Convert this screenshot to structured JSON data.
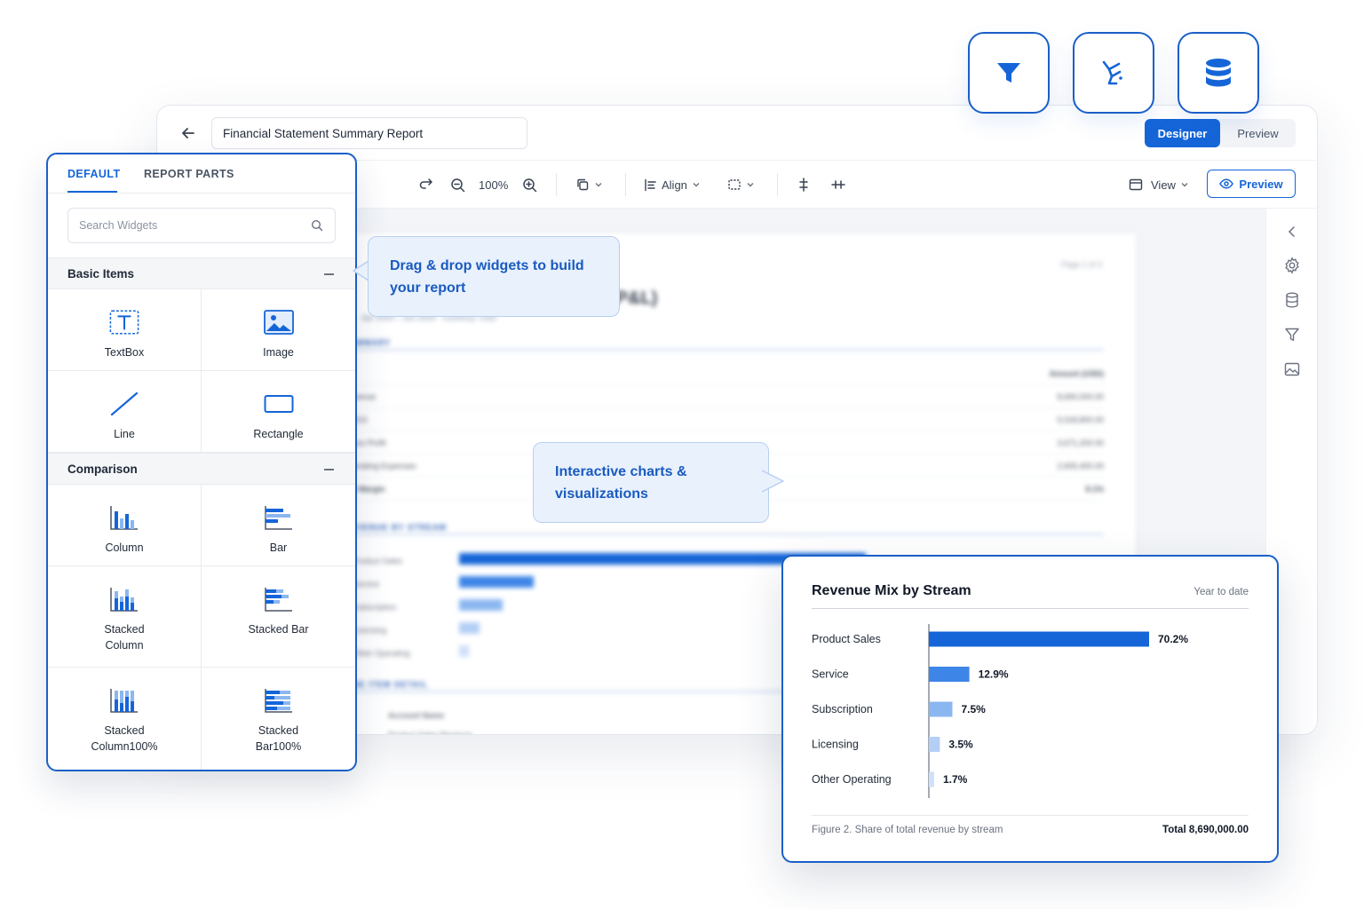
{
  "floating_tools": [
    {
      "name": "filter",
      "icon": "filter-icon"
    },
    {
      "name": "query",
      "icon": "wand-icon"
    },
    {
      "name": "data-source",
      "icon": "database-icon"
    }
  ],
  "header": {
    "report_title": "Financial Statement Summary Report",
    "mode_designer": "Designer",
    "mode_preview": "Preview"
  },
  "toolbar": {
    "zoom": "100%",
    "align_label": "Align",
    "view_label": "View",
    "preview_label": "Preview"
  },
  "widgets_panel": {
    "tabs": [
      "DEFAULT",
      "REPORT PARTS"
    ],
    "active_tab": 0,
    "search_placeholder": "Search Widgets",
    "groups": [
      {
        "label": "Basic Items",
        "items": [
          "TextBox",
          "Image",
          "Line",
          "Rectangle"
        ]
      },
      {
        "label": "Comparison",
        "items": [
          "Column",
          "Bar",
          "Stacked Column",
          "Stacked Bar",
          "Stacked Column100%",
          "Stacked Bar100%"
        ]
      }
    ]
  },
  "callouts": {
    "drag_drop": "Drag & drop widgets to build your report",
    "interactive": "Interactive charts & visualizations"
  },
  "revenue_card": {
    "title": "Revenue Mix by Stream",
    "period": "Year to date",
    "caption": "Figure 2. Share of total revenue by stream",
    "total": "Total 8,690,000.00"
  },
  "chart_data": {
    "type": "bar",
    "orientation": "horizontal",
    "title": "Revenue Mix by Stream",
    "subtitle": "Year to date",
    "categories": [
      "Product Sales",
      "Service",
      "Subscription",
      "Licensing",
      "Other Operating"
    ],
    "values": [
      70.2,
      12.9,
      7.5,
      3.5,
      1.7
    ],
    "data_labels": [
      "70.2%",
      "12.9%",
      "7.5%",
      "3.5%",
      "1.7%"
    ],
    "colors": [
      "#1565d8",
      "#3d85e6",
      "#8bb7f0",
      "#b3cff6",
      "#cfe0fa"
    ],
    "xlim": [
      0,
      70.2
    ],
    "grid": false,
    "legend": "none"
  },
  "colors": {
    "accent": "#1565d8",
    "border_accent": "#1a5fc8",
    "callout_bg": "#e9f1fd",
    "callout_text": "#1a5bbf"
  }
}
